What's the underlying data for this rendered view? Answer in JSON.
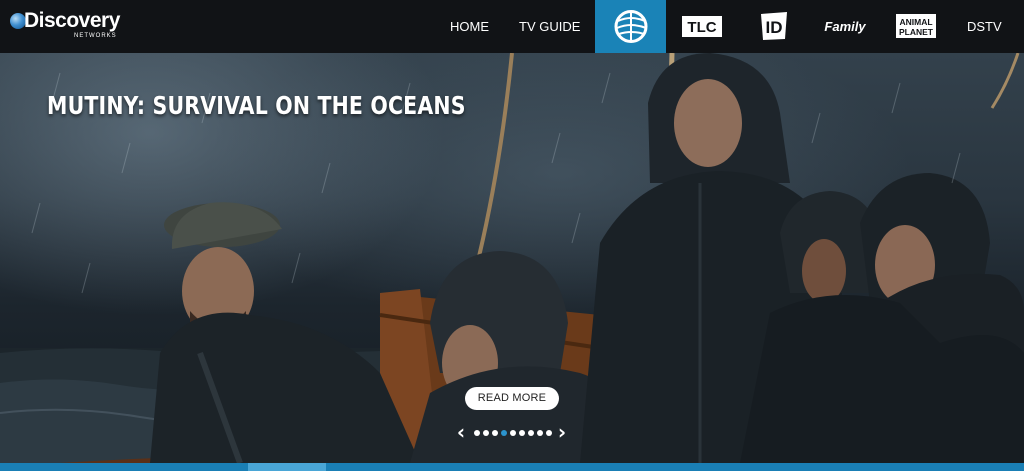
{
  "brand": {
    "name": "Discovery",
    "sub": "NETWORKS"
  },
  "nav": {
    "home": "HOME",
    "tv_guide": "TV GUIDE",
    "dstv": "DSTV",
    "channels": [
      {
        "name": "Discovery Channel",
        "icon": "discovery-d-icon",
        "active": true
      },
      {
        "name": "TLC",
        "icon": "tlc-logo",
        "label": "TLC"
      },
      {
        "name": "Investigation Discovery",
        "icon": "id-logo",
        "label": "ID"
      },
      {
        "name": "Discovery Family",
        "icon": "discovery-family-logo",
        "label": "Family"
      },
      {
        "name": "Animal Planet",
        "icon": "animal-planet-logo",
        "label": "ANIMAL PLANET"
      }
    ]
  },
  "hero": {
    "title": "MUTINY: SURVIVAL ON THE OCEANS",
    "cta_label": "READ MORE",
    "slides_total": 9,
    "active_slide": 4
  },
  "colors": {
    "nav_bg": "#111316",
    "accent": "#1a83b7",
    "strip": "#1a7fb5"
  }
}
